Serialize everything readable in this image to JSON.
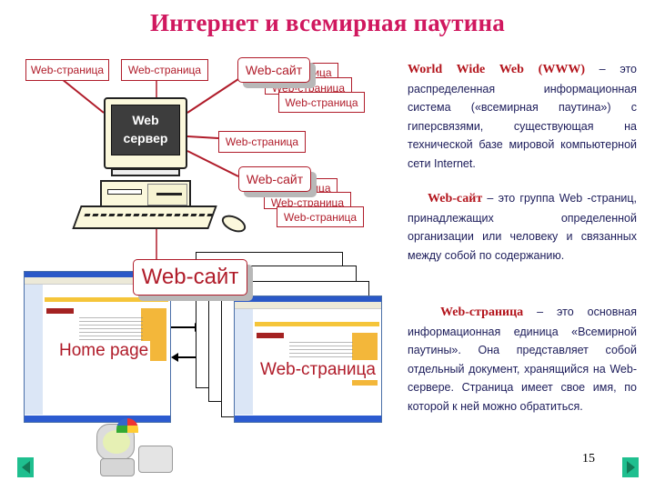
{
  "title": "Интернет и всемирная паутина",
  "diagram": {
    "server_label_line1": "Web",
    "server_label_line2": "сервер",
    "top_pages": [
      "Web-страница",
      "Web-страница"
    ],
    "right_page": "Web-страница",
    "site_group_1": {
      "site_label": "Web-сайт",
      "pages": [
        "Web-страница",
        "Web-страница",
        "Web-страница"
      ]
    },
    "site_group_2": {
      "site_label": "Web-сайт",
      "pages": [
        "Web-страница",
        "Web-страница",
        "Web-страница"
      ]
    },
    "bottom_site_label": "Web-сайт",
    "home_page_label": "Home page",
    "web_page_label": "Web-страница"
  },
  "definitions": [
    {
      "term": "World Wide Web (WWW)",
      "text": " – это распределенная информационная система («всемирная паутина») с гиперсвязями, существующая на технической базе мировой компьютерной сети Internet."
    },
    {
      "term": "Web-сайт",
      "text": " – это группа Web -страниц, принадлежащих определенной организации или человеку и связанных между собой по содержанию."
    },
    {
      "term": "Web-страница",
      "text": " – это основная информационная единица «Всемирной паутины». Она представляет собой отдельный документ, хранящийся на Web-сервере. Страница имеет свое имя, по которой к ней можно обратиться."
    }
  ],
  "footer": {
    "page_number": "15",
    "prev_icon": "triangle-left",
    "next_icon": "triangle-right"
  },
  "colors": {
    "title": "#d0185f",
    "accent_red": "#b01c2a",
    "body_text": "#1c1c5a",
    "nav_button": "#1fbf8f"
  }
}
